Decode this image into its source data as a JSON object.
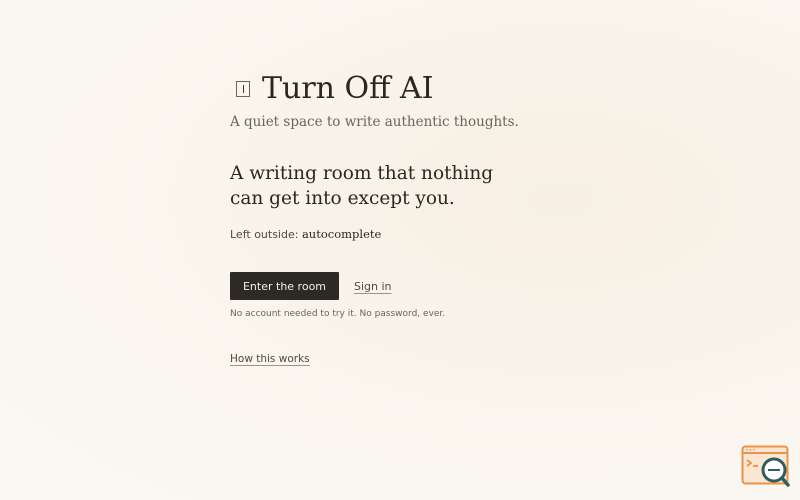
{
  "brand": {
    "title": "Turn Off AI",
    "tagline": "A quiet space to write authentic thoughts.",
    "logo_icon": "text-cursor-icon"
  },
  "hero": {
    "headline": "A writing room that nothing can get into except you.",
    "left_outside_label": "Left outside:",
    "left_outside_value": "autocomplete"
  },
  "actions": {
    "enter_label": "Enter the room",
    "signin_label": "Sign in",
    "note": "No account needed to try it. No password, ever."
  },
  "footer": {
    "how_label": "How this works"
  },
  "widget": {
    "icon": "browser-search-icon"
  },
  "colors": {
    "background": "#faf6ef",
    "primary_button": "#2d2a25",
    "widget_accent": "#e8934a",
    "widget_magnifier": "#2f5d62"
  }
}
